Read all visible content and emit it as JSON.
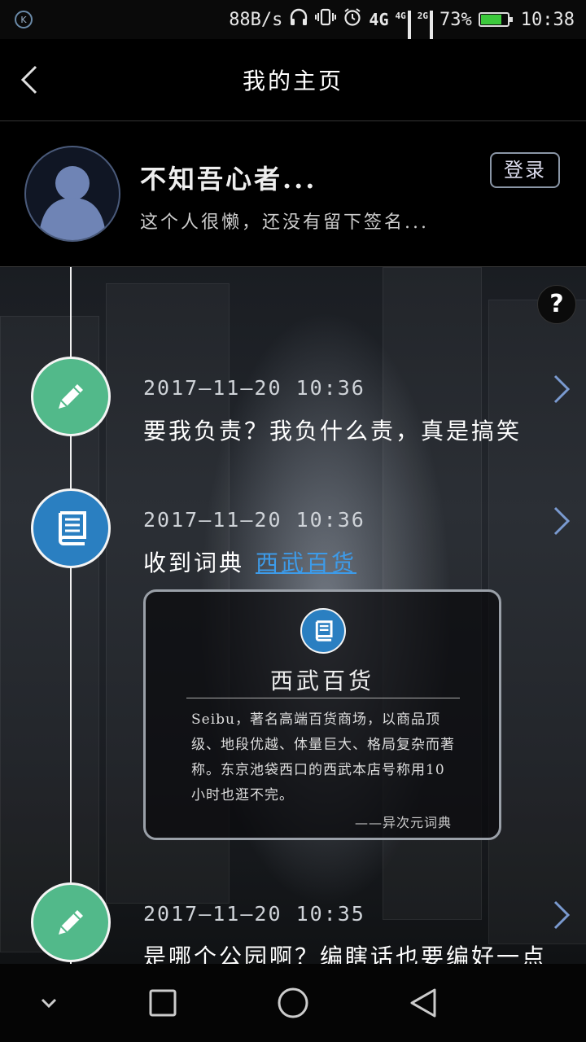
{
  "status_bar": {
    "app_icon": "K",
    "speed": "88B/s",
    "network_1": "4G",
    "network_2": "4G",
    "network_3": "2G",
    "battery": "73%",
    "battery_level": 0.73,
    "time": "10:38"
  },
  "header": {
    "title": "我的主页",
    "back_icon": "back-arrow-icon"
  },
  "profile": {
    "username": "不知吾心者...",
    "signature": "这个人很懒，还没有留下签名...",
    "login_label": "登录"
  },
  "help": {
    "label": "?"
  },
  "feed": {
    "entries": [
      {
        "icon": "pencil-icon",
        "timestamp": "2017—11—20 10:36",
        "text": "要我负责？我负什么责，真是搞笑"
      },
      {
        "icon": "book-icon",
        "timestamp": "2017—11—20 10:36",
        "text": "收到词典",
        "link": "西武百货"
      },
      {
        "icon": "pencil-icon",
        "timestamp": "2017—11—20 10:35",
        "text": "是哪个公园啊？编瞎话也要编好一点"
      }
    ],
    "dictionary_card": {
      "title": "西武百货",
      "description": "Seibu，著名高端百货商场，以商品顶级、地段优越、体量巨大、格局复杂而著称。东京池袋西口的西武本店号称用10小时也逛不完。",
      "source": "——异次元词典"
    }
  },
  "colors": {
    "green_node": "#52b98a",
    "blue_node": "#2a7fc1",
    "link": "#3d9be9"
  }
}
